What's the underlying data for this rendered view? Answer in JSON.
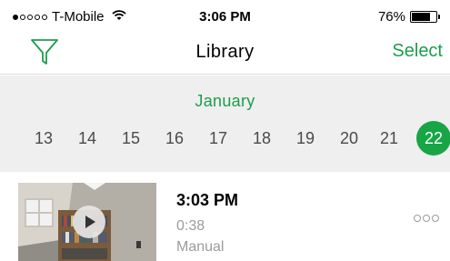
{
  "status_bar": {
    "carrier": "T-Mobile",
    "signal_icon": "signal-dots-icon",
    "wifi_icon": "wifi-icon",
    "time": "3:06 PM",
    "battery_percent": "76%",
    "battery_level": 0.76
  },
  "nav": {
    "filter_icon": "filter-funnel-icon",
    "title": "Library",
    "select_label": "Select",
    "accent_color": "#1b9e4b"
  },
  "calendar": {
    "month": "January",
    "days": [
      "13",
      "14",
      "15",
      "16",
      "17",
      "18",
      "19",
      "20",
      "21",
      "22"
    ],
    "selected_day": "22",
    "selected_color": "#17a546"
  },
  "recordings": [
    {
      "time": "3:03 PM",
      "duration": "0:38",
      "type": "Manual",
      "thumbnail": "room-bookshelf-thumbnail",
      "play_icon": "play-icon",
      "more_icon": "more-options-icon"
    }
  ]
}
